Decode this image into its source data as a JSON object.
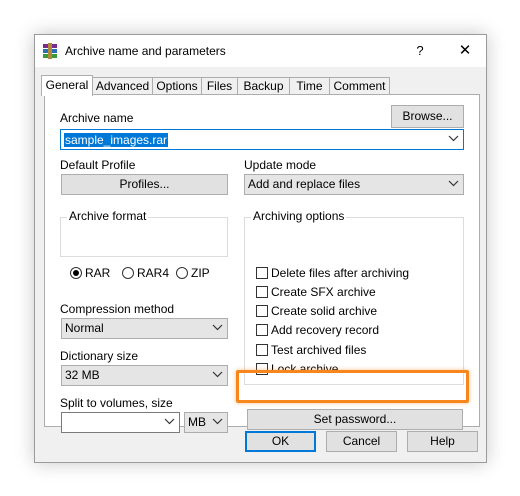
{
  "window": {
    "title": "Archive name and parameters",
    "help": "?",
    "close": "✕"
  },
  "tabs": [
    "General",
    "Advanced",
    "Options",
    "Files",
    "Backup",
    "Time",
    "Comment"
  ],
  "archive_name": {
    "label": "Archive name",
    "value": "sample_images.rar",
    "browse": "Browse..."
  },
  "default_profile": {
    "label": "Default Profile",
    "button": "Profiles..."
  },
  "update_mode": {
    "label": "Update mode",
    "value": "Add and replace files"
  },
  "archive_format": {
    "label": "Archive format",
    "options": [
      "RAR",
      "RAR4",
      "ZIP"
    ],
    "selected": "RAR"
  },
  "compression": {
    "label": "Compression method",
    "value": "Normal"
  },
  "dictionary": {
    "label": "Dictionary size",
    "value": "32 MB"
  },
  "split": {
    "label": "Split to volumes, size",
    "value": "",
    "unit": "MB"
  },
  "archiving_options": {
    "label": "Archiving options",
    "items": [
      "Delete files after archiving",
      "Create SFX archive",
      "Create solid archive",
      "Add recovery record",
      "Test archived files",
      "Lock archive"
    ]
  },
  "set_password": "Set password...",
  "footer": {
    "ok": "OK",
    "cancel": "Cancel",
    "help": "Help"
  },
  "colors": {
    "highlight": "#f7861c",
    "selection": "#0078d7",
    "focus": "#0078d7"
  }
}
